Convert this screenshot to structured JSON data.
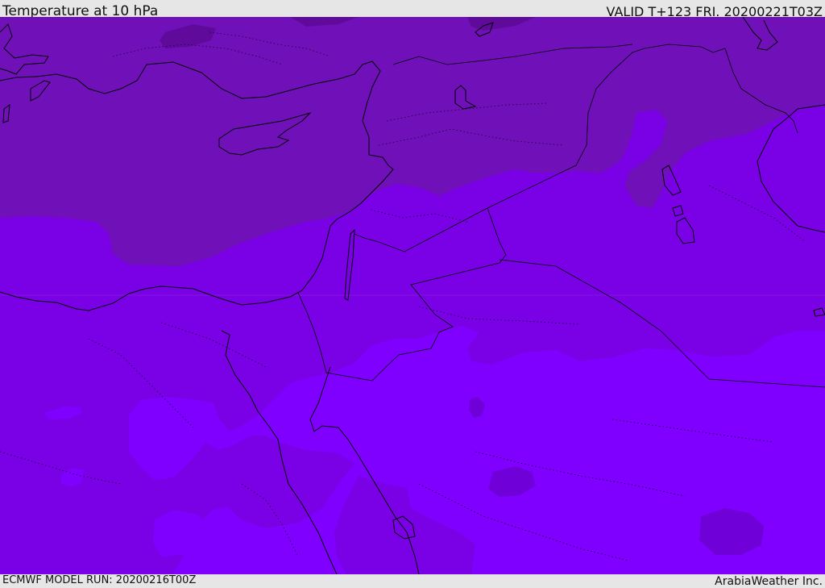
{
  "header": {
    "title": "Temperature at 10 hPa",
    "valid": "VALID T+123 FRI. 20200221T03Z"
  },
  "footer": {
    "model_run": "ECMWF MODEL RUN: 20200216T00Z",
    "credit": "ArabiaWeather Inc."
  },
  "colors": {
    "cold_band": "#7010b8",
    "mid_band": "#7a00e6",
    "warm_band": "#8000ff",
    "coldest_patch": "#600a9c",
    "coastline": "#000000",
    "background_bar": "#e6e6e6"
  }
}
